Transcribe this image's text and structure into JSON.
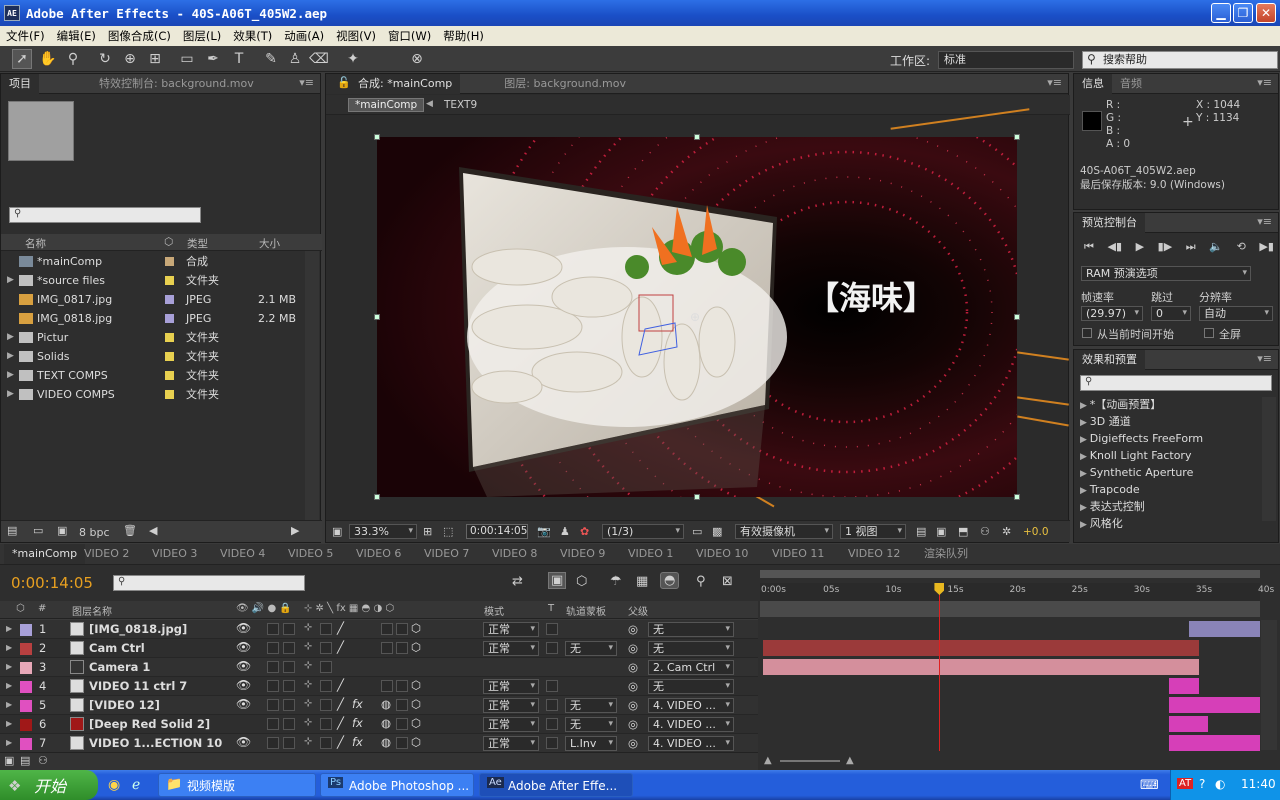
{
  "window": {
    "title": "Adobe After Effects - 40S-A06T_405W2.aep",
    "app_icon": "AE"
  },
  "menu": [
    "文件(F)",
    "编辑(E)",
    "图像合成(C)",
    "图层(L)",
    "效果(T)",
    "动画(A)",
    "视图(V)",
    "窗口(W)",
    "帮助(H)"
  ],
  "toolbar": {
    "workspace_label": "工作区:",
    "workspace_value": "标准",
    "help_placeholder": "搜索帮助"
  },
  "project": {
    "tabs": [
      "项目",
      "特效控制台: background.mov"
    ],
    "columns": [
      "名称",
      "类型",
      "大小"
    ],
    "items": [
      {
        "name": "*mainComp",
        "type": "合成",
        "size": "",
        "icon": "comp-icon",
        "label_color": "#c8a878"
      },
      {
        "name": "*source files",
        "type": "文件夹",
        "size": "",
        "icon": "folder-icon",
        "label_color": "#e8d050"
      },
      {
        "name": "IMG_0817.jpg",
        "type": "JPEG",
        "size": "2.1 MB",
        "icon": "image-icon",
        "label_color": "#a8a0d8"
      },
      {
        "name": "IMG_0818.jpg",
        "type": "JPEG",
        "size": "2.2 MB",
        "icon": "image-icon",
        "label_color": "#a8a0d8"
      },
      {
        "name": "Pictur",
        "type": "文件夹",
        "size": "",
        "icon": "folder-icon",
        "label_color": "#e8d050"
      },
      {
        "name": "Solids",
        "type": "文件夹",
        "size": "",
        "icon": "folder-icon",
        "label_color": "#e8d050"
      },
      {
        "name": "TEXT COMPS",
        "type": "文件夹",
        "size": "",
        "icon": "folder-icon",
        "label_color": "#e8d050"
      },
      {
        "name": "VIDEO COMPS",
        "type": "文件夹",
        "size": "",
        "icon": "folder-icon",
        "label_color": "#e8d050"
      }
    ],
    "bpc": "8 bpc"
  },
  "composition": {
    "tab": "合成: *mainComp",
    "layer_tab": "图层: background.mov",
    "breadcrumb": [
      "*mainComp",
      "TEXT9"
    ],
    "overlay_text": "【海味】",
    "zoom": "33.3%",
    "timecode": "0:00:14:05",
    "resolution": "(1/3)",
    "camera": "有效摄像机",
    "views": "1 视图",
    "exposure": "+0.0"
  },
  "info": {
    "tabs": [
      "信息",
      "音频"
    ],
    "r": "R :",
    "g": "G :",
    "b": "B :",
    "a": "A : 0",
    "x": "X : 1044",
    "y": "Y : 1134",
    "file": "40S-A06T_405W2.aep",
    "saved": "最后保存版本: 9.0 (Windows)"
  },
  "preview": {
    "tab": "预览控制台",
    "ram": "RAM 预演选项",
    "labels": [
      "帧速率",
      "跳过",
      "分辨率"
    ],
    "values": [
      "(29.97)",
      "0",
      "自动"
    ],
    "from_current": "从当前时间开始",
    "fullscreen": "全屏"
  },
  "effects": {
    "tab": "效果和预置",
    "items": [
      "*【动画预置】",
      "3D 通道",
      "Digieffects FreeForm",
      "Knoll Light Factory",
      "Synthetic Aperture",
      "Trapcode",
      "表达式控制",
      "风格化"
    ]
  },
  "timeline": {
    "tabs": [
      "*mainComp",
      "VIDEO 2",
      "VIDEO 3",
      "VIDEO 4",
      "VIDEO 5",
      "VIDEO 6",
      "VIDEO 7",
      "VIDEO 8",
      "VIDEO 9",
      "VIDEO 1",
      "VIDEO 10",
      "VIDEO 11",
      "VIDEO 12",
      "渲染队列"
    ],
    "timecode": "0:00:14:05",
    "headers": {
      "num": "#",
      "name": "图层名称",
      "mode": "模式",
      "t": "T",
      "trkmat": "轨道蒙板",
      "parent": "父级"
    },
    "ruler": [
      "0:00s",
      "05s",
      "10s",
      "15s",
      "20s",
      "25s",
      "30s",
      "35s",
      "40s"
    ],
    "playhead_seconds": 14.2,
    "duration_seconds": 40,
    "layers": [
      {
        "num": "1",
        "name": "[IMG_0818.jpg]",
        "label": "#a8a0d8",
        "mode": "正常",
        "trkmat": "",
        "parent": "无",
        "bar": {
          "start": 34.3,
          "end": 40,
          "color": "#8a84b8"
        }
      },
      {
        "num": "2",
        "name": "Cam Ctrl",
        "label": "#b84040",
        "mode": "正常",
        "trkmat": "无",
        "parent": "无",
        "bar": {
          "start": 0,
          "end": 35.1,
          "color": "#9b3a3a"
        }
      },
      {
        "num": "3",
        "name": "Camera 1",
        "label": "#e8a8b8",
        "mode": "",
        "trkmat": "",
        "parent": "2. Cam Ctrl",
        "bar": {
          "start": 0,
          "end": 35.1,
          "color": "#d48f9c"
        }
      },
      {
        "num": "4",
        "name": "VIDEO 11 ctrl 7",
        "label": "#e050c0",
        "mode": "正常",
        "trkmat": "",
        "parent": "无",
        "bar": {
          "start": 32.7,
          "end": 35.1,
          "color": "#d63fb8"
        }
      },
      {
        "num": "5",
        "name": "[VIDEO 12]",
        "label": "#e050c0",
        "mode": "正常",
        "trkmat": "无",
        "parent": "4. VIDEO ...",
        "bar": {
          "start": 32.7,
          "end": 40,
          "color": "#d63fb8"
        }
      },
      {
        "num": "6",
        "name": "[Deep Red Solid 2]",
        "label": "#a01818",
        "mode": "正常",
        "trkmat": "无",
        "parent": "4. VIDEO ...",
        "bar": {
          "start": 32.7,
          "end": 35.8,
          "color": "#d63fb8"
        }
      },
      {
        "num": "7",
        "name": "VIDEO 1...ECTION 10",
        "label": "#e050c0",
        "mode": "正常",
        "trkmat": "L.Inv",
        "parent": "4. VIDEO ...",
        "bar": {
          "start": 32.7,
          "end": 40,
          "color": "#d63fb8"
        }
      }
    ]
  },
  "taskbar": {
    "start": "开始",
    "tasks": [
      "视频模版",
      "Adobe Photoshop ...",
      "Adobe After Effe..."
    ],
    "time": "11:40"
  }
}
